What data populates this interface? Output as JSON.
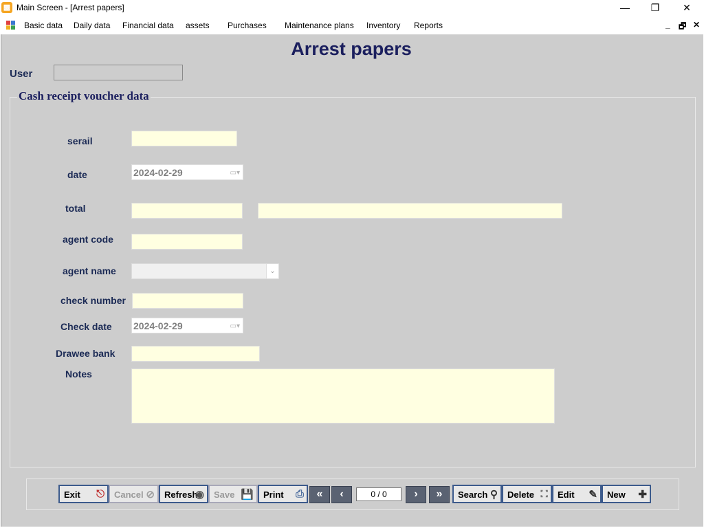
{
  "window": {
    "title": "Main Screen - [Arrest papers]",
    "minimize_glyph": "—",
    "restore_glyph": "❐",
    "close_glyph": "✕"
  },
  "menu": {
    "items": [
      "Basic data",
      "Daily data",
      "Financial data",
      "assets",
      "Purchases",
      "Maintenance plans",
      "Inventory",
      "Reports"
    ],
    "mdi_minimize": "_",
    "mdi_restore": "🗗",
    "mdi_close": "✕"
  },
  "page": {
    "title": "Arrest papers",
    "user_label": "User",
    "user_value": ""
  },
  "form": {
    "group_title": "Cash receipt voucher data",
    "serail_label": "serail",
    "serail_value": "",
    "date_label": "date",
    "date_value": "2024-02-29",
    "total_label": "total",
    "total_value": "",
    "total_words_value": "",
    "agent_code_label": "agent code",
    "agent_code_value": "",
    "agent_name_label": "agent name",
    "agent_name_value": "",
    "check_number_label": "check number",
    "check_number_value": "",
    "check_date_label": "Check date",
    "check_date_value": "2024-02-29",
    "drawee_bank_label": "Drawee bank",
    "drawee_bank_value": "",
    "notes_label": "Notes",
    "notes_value": ""
  },
  "toolbar": {
    "exit": "Exit",
    "cancel": "Cancel",
    "refresh": "Refresh",
    "save": "Save",
    "print": "Print",
    "counter": "0 / 0",
    "search": "Search",
    "delete": "Delete",
    "edit": "Edit",
    "new": "New"
  },
  "colors": {
    "client_bg": "#cdcdcd",
    "input_bg": "#ffffe1",
    "title_color": "#1b1f5e",
    "button_border": "#3c5a8c"
  }
}
